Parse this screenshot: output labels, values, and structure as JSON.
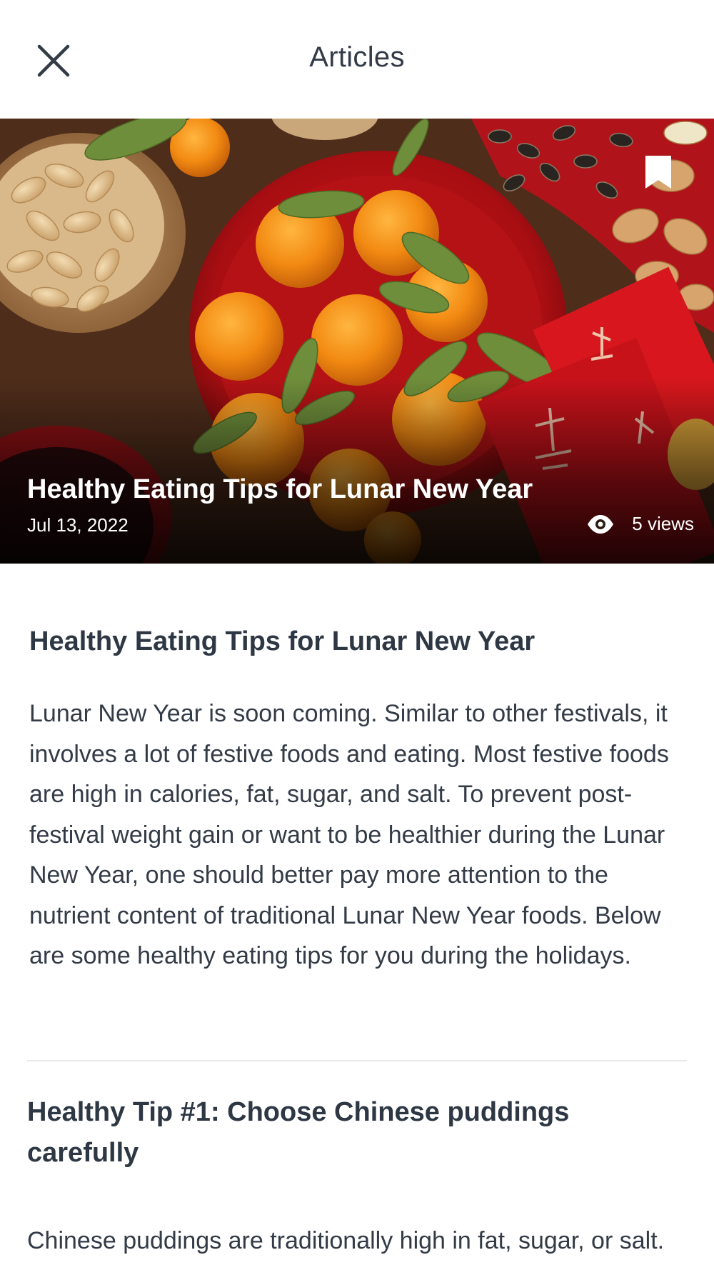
{
  "header": {
    "title": "Articles",
    "close_icon": "close-icon"
  },
  "hero": {
    "title": "Healthy Eating Tips for Lunar New Year",
    "date": "Jul 13, 2022",
    "views": "5 views",
    "bookmark_icon": "bookmark-icon",
    "views_icon": "eye-icon"
  },
  "article": {
    "heading": "Healthy Eating Tips for Lunar New Year",
    "intro": "Lunar New Year is soon coming. Similar to other festivals, it involves a lot of festive foods and eating. Most festive foods are high in calories, fat, sugar, and salt. To prevent post-festival weight gain or want to be healthier during the Lunar New Year, one should better pay more attention to the nutrient content of traditional Lunar New Year foods. Below are some healthy eating tips for you during the holidays.",
    "tips": [
      {
        "heading": "Healthy Tip #1: Choose Chinese puddings carefully",
        "body": "Chinese puddings are traditionally high in fat, sugar, or salt. Across all popular Chinese puddings, Chinese"
      }
    ]
  }
}
